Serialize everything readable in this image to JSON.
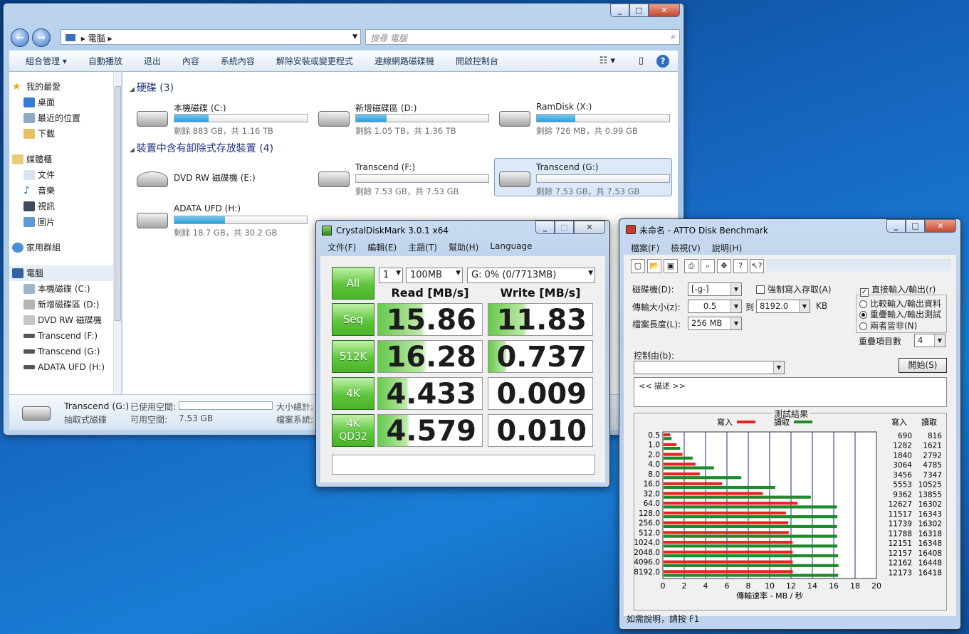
{
  "explorer": {
    "nav_back": "←",
    "nav_forward": "→",
    "address_path": [
      "電腦"
    ],
    "search_placeholder": "搜尋 電腦",
    "toolbar": [
      "組合管理 ▾",
      "自動播放",
      "退出",
      "內容",
      "系統內容",
      "解除安裝或變更程式",
      "連線網路磁碟機",
      "開啟控制台"
    ],
    "nav_items": {
      "favorites": {
        "label": "我的最愛",
        "items": [
          "桌面",
          "最近的位置",
          "下載"
        ]
      },
      "libraries": {
        "label": "媒體櫃",
        "items": [
          "文件",
          "音樂",
          "視訊",
          "圖片"
        ]
      },
      "homegroup": "家用群組",
      "computer": {
        "label": "電腦",
        "items": [
          "本機磁碟 (C:)",
          "新增磁碟區 (D:)",
          "DVD RW 磁碟機",
          "Transcend (F:)",
          "Transcend (G:)",
          "ADATA UFD (H:)"
        ]
      }
    },
    "groups": {
      "hdd": "硬碟 (3)",
      "removable": "裝置中含有卸除式存放裝置 (4)"
    },
    "drives": [
      {
        "name": "本機磁碟 (C:)",
        "size": "剩餘 883 GB，共 1.16 TB",
        "used_fraction": 0.26
      },
      {
        "name": "新增磁碟區 (D:)",
        "size": "剩餘 1.05 TB，共 1.36 TB",
        "used_fraction": 0.23
      },
      {
        "name": "RamDisk (X:)",
        "size": "剩餘 726 MB，共 0.99 GB",
        "used_fraction": 0.29
      },
      {
        "name": "DVD RW 磁碟機 (E:)",
        "size": ""
      },
      {
        "name": "Transcend (F:)",
        "size": "剩餘 7.53 GB，共 7.53 GB",
        "used_fraction": 0.0
      },
      {
        "name": "Transcend (G:)",
        "size": "剩餘 7.53 GB，共 7.53 GB",
        "used_fraction": 0.0
      },
      {
        "name": "ADATA UFD (H:)",
        "size": "剩餘 18.7 GB，共 30.2 GB",
        "used_fraction": 0.38
      }
    ],
    "details": {
      "name": "Transcend (G:)",
      "type": "抽取式磁碟",
      "used_label": "已使用空間:",
      "free_label": "可用空間:",
      "free_value": "7.53 GB",
      "total_label": "大小總計:",
      "fs_label": "檔案系統:"
    }
  },
  "crystal": {
    "title": "CrystalDiskMark 3.0.1 x64",
    "menu": [
      "文件(F)",
      "編輯(E)",
      "主題(T)",
      "幫助(H)",
      "Language"
    ],
    "all_button": "All",
    "count": "1",
    "size": "100MB",
    "drive": "G: 0% (0/7713MB)",
    "read_header": "Read [MB/s]",
    "write_header": "Write [MB/s]",
    "rows": [
      {
        "label": "Seq",
        "read": "15.86",
        "write": "11.83"
      },
      {
        "label": "512K",
        "read": "16.28",
        "write": "0.737"
      },
      {
        "label": "4K",
        "read": "4.433",
        "write": "0.009"
      },
      {
        "label": "4K\nQD32",
        "read": "4.579",
        "write": "0.010"
      }
    ]
  },
  "atto": {
    "title": "未命名 - ATTO Disk Benchmark",
    "menu": [
      "檔案(F)",
      "檢視(V)",
      "說明(H)"
    ],
    "drive_label": "磁碟機(D):",
    "drive_value": "[-g-]",
    "force_write_label": "強制寫入存取(A)",
    "direct_io_label": "直接輸入/輸出(r)",
    "transfer_label": "傳輸大小(z):",
    "transfer_from": "0.5",
    "to_label": "到",
    "transfer_to": "8192.0",
    "kb_label": "KB",
    "length_label": "檔案長度(L):",
    "length_value": "256 MB",
    "radio_options": [
      "比較輸入/輸出資料",
      "重疊輸入/輸出測試",
      "兩者皆非(N)"
    ],
    "queue_label": "重疊項目數",
    "queue_value": "4",
    "control_label": "控制由(b):",
    "start_button": "開始(S)",
    "desc_text": "<<   描述   >>",
    "results_title": "測試結果",
    "legend_write": "寫入",
    "legend_read": "讀取",
    "col_write": "寫入",
    "col_read": "讀取",
    "xlabel": "傳輸速率 - MB / 秒",
    "status": "如需說明，請按 F1",
    "colors": {
      "write": "#e8241c",
      "read": "#1e8a2a",
      "grid": "#1a2a9a"
    }
  },
  "chart_data": {
    "type": "bar",
    "orientation": "horizontal",
    "title": "測試結果",
    "xlabel": "傳輸速率 - MB / 秒",
    "xlim": [
      0,
      20
    ],
    "xticks": [
      0,
      2,
      4,
      6,
      8,
      10,
      12,
      14,
      16,
      18,
      20
    ],
    "categories": [
      "0.5",
      "1.0",
      "2.0",
      "4.0",
      "8.0",
      "16.0",
      "32.0",
      "64.0",
      "128.0",
      "256.0",
      "512.0",
      "1024.0",
      "2048.0",
      "4096.0",
      "8192.0"
    ],
    "series": [
      {
        "name": "寫入",
        "values": [
          690,
          1282,
          1840,
          3064,
          3456,
          5553,
          9362,
          12627,
          11517,
          11739,
          11788,
          12151,
          12157,
          12162,
          12173
        ]
      },
      {
        "name": "讀取",
        "values": [
          816,
          1621,
          2792,
          4785,
          7347,
          10525,
          13855,
          16302,
          16343,
          16302,
          16318,
          16348,
          16408,
          16448,
          16418
        ]
      }
    ],
    "legend": "top"
  }
}
